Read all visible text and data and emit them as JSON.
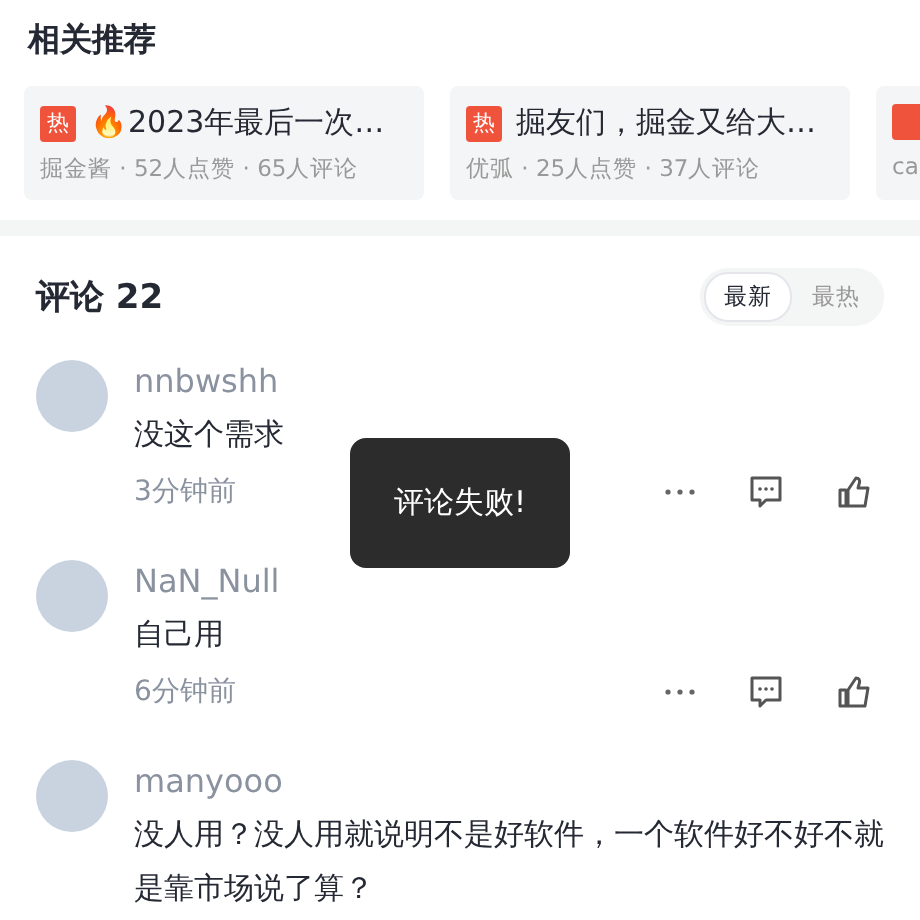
{
  "section_title": "相关推荐",
  "cards": [
    {
      "badge": "热",
      "title": "🔥2023年最后一次…",
      "meta": "掘金酱 · 52人点赞 · 65人评论"
    },
    {
      "badge": "热",
      "title": "掘友们，掘金又给大…",
      "meta": "优弧 · 25人点赞 · 37人评论"
    },
    {
      "meta": "ca"
    }
  ],
  "comments_header": {
    "title": "评论 22",
    "tabs": [
      {
        "label": "最新",
        "selected": true
      },
      {
        "label": "最热",
        "selected": false
      }
    ]
  },
  "comments": [
    {
      "user": "nnbwshh",
      "text": "没这个需求",
      "time": "3分钟前"
    },
    {
      "user": "NaN_Null",
      "text": "自己用",
      "time": "6分钟前"
    },
    {
      "user": "manyooo",
      "text": "没人用？没人用就说明不是好软件，一个软件好不好不就是靠市场说了算？"
    }
  ],
  "toast": "评论失败!"
}
